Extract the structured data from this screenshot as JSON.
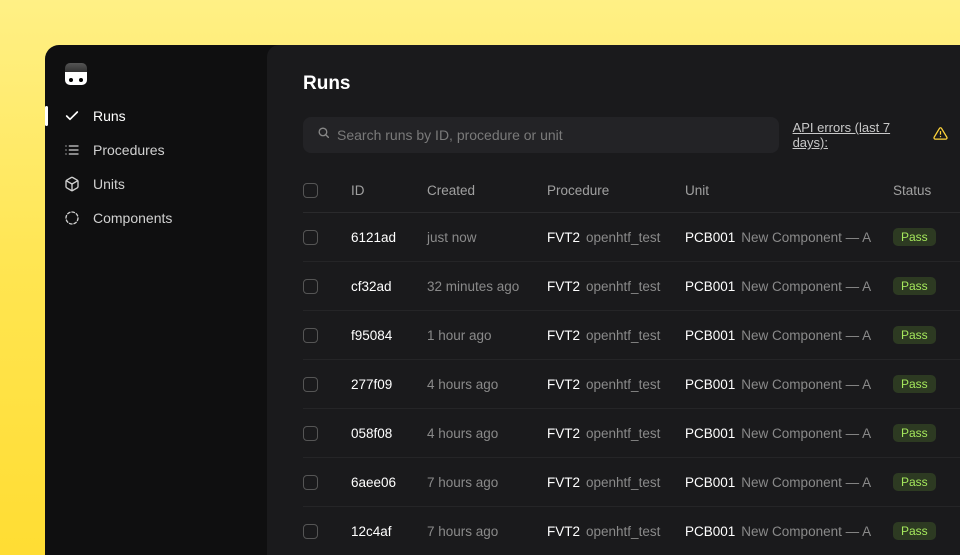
{
  "sidebar": {
    "items": [
      {
        "label": "Runs",
        "icon": "check",
        "active": true
      },
      {
        "label": "Procedures",
        "icon": "list",
        "active": false
      },
      {
        "label": "Units",
        "icon": "cube",
        "active": false
      },
      {
        "label": "Components",
        "icon": "circle-dashed",
        "active": false
      }
    ]
  },
  "page": {
    "title": "Runs"
  },
  "search": {
    "placeholder": "Search runs by ID, procedure or unit",
    "value": ""
  },
  "toolbar": {
    "api_errors_label": "API errors (last 7 days):"
  },
  "table": {
    "columns": {
      "id": "ID",
      "created": "Created",
      "procedure": "Procedure",
      "unit": "Unit",
      "status": "Status"
    },
    "rows": [
      {
        "id": "6121ad",
        "created": "just now",
        "procedure": "FVT2",
        "procedure_sub": "openhtf_test",
        "unit": "PCB001",
        "unit_sub": "New Component — A",
        "status": "Pass"
      },
      {
        "id": "cf32ad",
        "created": "32 minutes ago",
        "procedure": "FVT2",
        "procedure_sub": "openhtf_test",
        "unit": "PCB001",
        "unit_sub": "New Component — A",
        "status": "Pass"
      },
      {
        "id": "f95084",
        "created": "1 hour ago",
        "procedure": "FVT2",
        "procedure_sub": "openhtf_test",
        "unit": "PCB001",
        "unit_sub": "New Component — A",
        "status": "Pass"
      },
      {
        "id": "277f09",
        "created": "4 hours ago",
        "procedure": "FVT2",
        "procedure_sub": "openhtf_test",
        "unit": "PCB001",
        "unit_sub": "New Component — A",
        "status": "Pass"
      },
      {
        "id": "058f08",
        "created": "4 hours ago",
        "procedure": "FVT2",
        "procedure_sub": "openhtf_test",
        "unit": "PCB001",
        "unit_sub": "New Component — A",
        "status": "Pass"
      },
      {
        "id": "6aee06",
        "created": "7 hours ago",
        "procedure": "FVT2",
        "procedure_sub": "openhtf_test",
        "unit": "PCB001",
        "unit_sub": "New Component — A",
        "status": "Pass"
      },
      {
        "id": "12c4af",
        "created": "7 hours ago",
        "procedure": "FVT2",
        "procedure_sub": "openhtf_test",
        "unit": "PCB001",
        "unit_sub": "New Component — A",
        "status": "Pass"
      }
    ]
  },
  "colors": {
    "pass_bg": "#2d3a22",
    "pass_fg": "#a5e85c",
    "accent_yellow": "#ffd43b"
  }
}
